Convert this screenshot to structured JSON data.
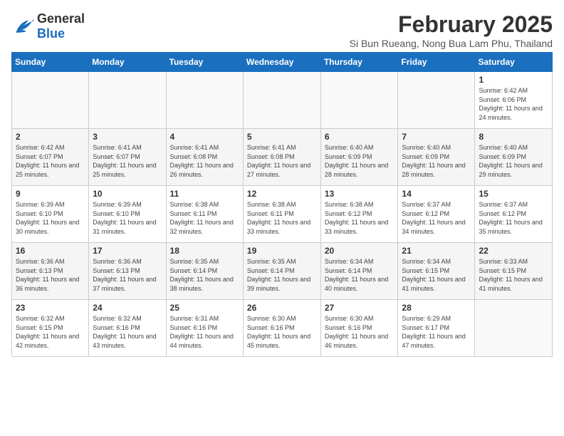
{
  "logo": {
    "general": "General",
    "blue": "Blue"
  },
  "header": {
    "month_title": "February 2025",
    "subtitle": "Si Bun Rueang, Nong Bua Lam Phu, Thailand"
  },
  "days_of_week": [
    "Sunday",
    "Monday",
    "Tuesday",
    "Wednesday",
    "Thursday",
    "Friday",
    "Saturday"
  ],
  "weeks": [
    [
      {
        "day": "",
        "info": ""
      },
      {
        "day": "",
        "info": ""
      },
      {
        "day": "",
        "info": ""
      },
      {
        "day": "",
        "info": ""
      },
      {
        "day": "",
        "info": ""
      },
      {
        "day": "",
        "info": ""
      },
      {
        "day": "1",
        "info": "Sunrise: 6:42 AM\nSunset: 6:06 PM\nDaylight: 11 hours and 24 minutes."
      }
    ],
    [
      {
        "day": "2",
        "info": "Sunrise: 6:42 AM\nSunset: 6:07 PM\nDaylight: 11 hours and 25 minutes."
      },
      {
        "day": "3",
        "info": "Sunrise: 6:41 AM\nSunset: 6:07 PM\nDaylight: 11 hours and 25 minutes."
      },
      {
        "day": "4",
        "info": "Sunrise: 6:41 AM\nSunset: 6:08 PM\nDaylight: 11 hours and 26 minutes."
      },
      {
        "day": "5",
        "info": "Sunrise: 6:41 AM\nSunset: 6:08 PM\nDaylight: 11 hours and 27 minutes."
      },
      {
        "day": "6",
        "info": "Sunrise: 6:40 AM\nSunset: 6:09 PM\nDaylight: 11 hours and 28 minutes."
      },
      {
        "day": "7",
        "info": "Sunrise: 6:40 AM\nSunset: 6:09 PM\nDaylight: 11 hours and 28 minutes."
      },
      {
        "day": "8",
        "info": "Sunrise: 6:40 AM\nSunset: 6:09 PM\nDaylight: 11 hours and 29 minutes."
      }
    ],
    [
      {
        "day": "9",
        "info": "Sunrise: 6:39 AM\nSunset: 6:10 PM\nDaylight: 11 hours and 30 minutes."
      },
      {
        "day": "10",
        "info": "Sunrise: 6:39 AM\nSunset: 6:10 PM\nDaylight: 11 hours and 31 minutes."
      },
      {
        "day": "11",
        "info": "Sunrise: 6:38 AM\nSunset: 6:11 PM\nDaylight: 11 hours and 32 minutes."
      },
      {
        "day": "12",
        "info": "Sunrise: 6:38 AM\nSunset: 6:11 PM\nDaylight: 11 hours and 33 minutes."
      },
      {
        "day": "13",
        "info": "Sunrise: 6:38 AM\nSunset: 6:12 PM\nDaylight: 11 hours and 33 minutes."
      },
      {
        "day": "14",
        "info": "Sunrise: 6:37 AM\nSunset: 6:12 PM\nDaylight: 11 hours and 34 minutes."
      },
      {
        "day": "15",
        "info": "Sunrise: 6:37 AM\nSunset: 6:12 PM\nDaylight: 11 hours and 35 minutes."
      }
    ],
    [
      {
        "day": "16",
        "info": "Sunrise: 6:36 AM\nSunset: 6:13 PM\nDaylight: 11 hours and 36 minutes."
      },
      {
        "day": "17",
        "info": "Sunrise: 6:36 AM\nSunset: 6:13 PM\nDaylight: 11 hours and 37 minutes."
      },
      {
        "day": "18",
        "info": "Sunrise: 6:35 AM\nSunset: 6:14 PM\nDaylight: 11 hours and 38 minutes."
      },
      {
        "day": "19",
        "info": "Sunrise: 6:35 AM\nSunset: 6:14 PM\nDaylight: 11 hours and 39 minutes."
      },
      {
        "day": "20",
        "info": "Sunrise: 6:34 AM\nSunset: 6:14 PM\nDaylight: 11 hours and 40 minutes."
      },
      {
        "day": "21",
        "info": "Sunrise: 6:34 AM\nSunset: 6:15 PM\nDaylight: 11 hours and 41 minutes."
      },
      {
        "day": "22",
        "info": "Sunrise: 6:33 AM\nSunset: 6:15 PM\nDaylight: 11 hours and 41 minutes."
      }
    ],
    [
      {
        "day": "23",
        "info": "Sunrise: 6:32 AM\nSunset: 6:15 PM\nDaylight: 11 hours and 42 minutes."
      },
      {
        "day": "24",
        "info": "Sunrise: 6:32 AM\nSunset: 6:16 PM\nDaylight: 11 hours and 43 minutes."
      },
      {
        "day": "25",
        "info": "Sunrise: 6:31 AM\nSunset: 6:16 PM\nDaylight: 11 hours and 44 minutes."
      },
      {
        "day": "26",
        "info": "Sunrise: 6:30 AM\nSunset: 6:16 PM\nDaylight: 11 hours and 45 minutes."
      },
      {
        "day": "27",
        "info": "Sunrise: 6:30 AM\nSunset: 6:16 PM\nDaylight: 11 hours and 46 minutes."
      },
      {
        "day": "28",
        "info": "Sunrise: 6:29 AM\nSunset: 6:17 PM\nDaylight: 11 hours and 47 minutes."
      },
      {
        "day": "",
        "info": ""
      }
    ]
  ]
}
